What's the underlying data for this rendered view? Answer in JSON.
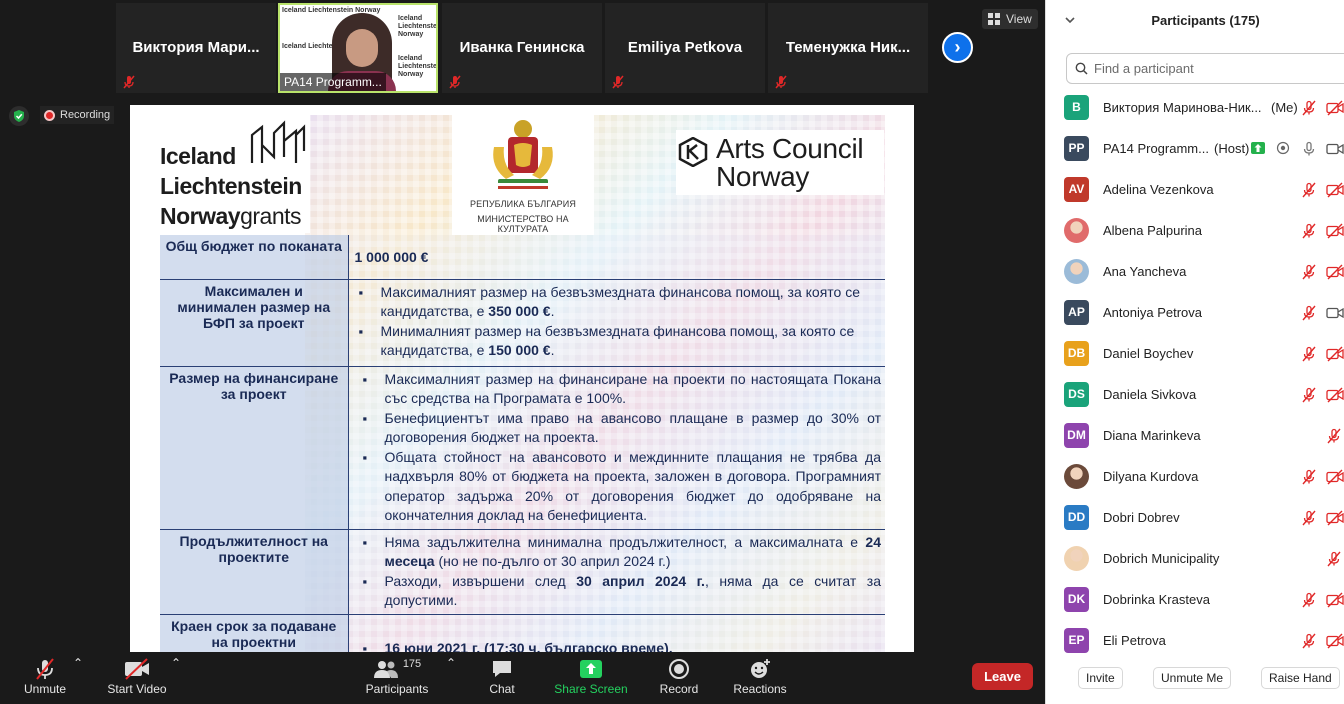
{
  "strip": {
    "tiles": [
      {
        "name": "Виктория  Мари..."
      },
      {
        "name": "PA14 Programm...",
        "watermark": "Iceland Liechtenstein Norway"
      },
      {
        "name": "Иванка Генинска"
      },
      {
        "name": "Emiliya Petkova"
      },
      {
        "name": "Теменужка  Ник..."
      }
    ],
    "view_label": "View"
  },
  "recording_label": "Recording",
  "slide": {
    "logo_eea": {
      "line1": "Iceland",
      "line2": "Liechtenstein",
      "line3a": "Norway",
      "line3b": "grants"
    },
    "logo_bg": {
      "line1": "РЕПУБЛИКА БЪЛГАРИЯ",
      "line2": "МИНИСТЕРСТВО НА КУЛТУРАТА"
    },
    "logo_arts": {
      "line1": "Arts Council",
      "line2": "Norway"
    },
    "rows": [
      {
        "label": "Общ бюджет по поканата",
        "value": "1 000 000 €"
      },
      {
        "label": "Максимален и минимален размер на БФП за проект",
        "items": [
          {
            "pre": "Максималният размер на безвъзмездната финансова помощ, за която се кандидатства, е ",
            "bold": "350 000 €",
            "post": "."
          },
          {
            "pre": "Минималният размер на безвъзмездната финансова помощ, за която се кандидатства, е ",
            "bold": "150 000 €",
            "post": "."
          }
        ]
      },
      {
        "label": "Размер на финансиране за проект",
        "items": [
          {
            "pre": "Максималният размер на финансиране на проекти по настоящата Покана със средства на Програмата е 100%.",
            "bold": "",
            "post": ""
          },
          {
            "pre": "Бенефициентът има право на авансово плащане в размер до 30% от договорения бюджет на проекта.",
            "bold": "",
            "post": ""
          },
          {
            "pre": "Общата стойност на авансовото и междинните плащания не трябва да надхвърля 80% от бюджета на проекта, заложен в договора. Програмният оператор задържа 20% от договорения бюджет до одобряване на окончателния доклад на бенефициента.",
            "bold": "",
            "post": ""
          }
        ]
      },
      {
        "label": "Продължителност на проектите",
        "items": [
          {
            "pre": "Няма задължителна минимална продължителност, а максималната е ",
            "bold": "24 месеца",
            "post": " (но не по-дълго от 30 април 2024 г.)"
          },
          {
            "pre": "Разходи, извършени след ",
            "bold": "30 април 2024 г.",
            "post": ", няма да се считат за допустими."
          }
        ]
      },
      {
        "label": "Краен срок за подаване на проектни",
        "items": [
          {
            "pre": "",
            "bold": "16 юни 2021 г. (17:30 ч. българско време).",
            "post": ""
          }
        ]
      }
    ]
  },
  "toolbar": {
    "unmute": "Unmute",
    "start_video": "Start Video",
    "participants": "Participants",
    "participants_count": "175",
    "chat": "Chat",
    "share_screen": "Share Screen",
    "record": "Record",
    "reactions": "Reactions",
    "leave": "Leave"
  },
  "panel": {
    "title": "Participants (175)",
    "search_placeholder": "Find a participant",
    "participants": [
      {
        "initials": "В",
        "name": "Виктория Маринова-Ник...",
        "tag": "(Me)",
        "color": "#1aa37a",
        "icons": [
          "mic-muted",
          "video-off"
        ]
      },
      {
        "initials": "PP",
        "name": "PA14 Programm...",
        "tag": "(Host)",
        "color": "#3a4a5e",
        "icons": [
          "share",
          "record-dot",
          "mic",
          "video"
        ]
      },
      {
        "initials": "AV",
        "name": "Adelina Vezenkova",
        "tag": "",
        "color": "#c0392b",
        "icons": [
          "mic-muted",
          "video-off"
        ]
      },
      {
        "initials": "",
        "name": "Albena Palpurina",
        "tag": "",
        "color": "#d44",
        "photo": "#e06b6b",
        "icons": [
          "mic-muted",
          "video-off"
        ]
      },
      {
        "initials": "",
        "name": "Ana Yancheva",
        "tag": "",
        "color": "#7a9cbf",
        "photo": "#9bbbd8",
        "icons": [
          "mic-muted",
          "video-off"
        ]
      },
      {
        "initials": "AP",
        "name": "Antoniya Petrova",
        "tag": "",
        "color": "#3a4a5e",
        "icons": [
          "mic-muted",
          "video"
        ]
      },
      {
        "initials": "DB",
        "name": "Daniel Boychev",
        "tag": "",
        "color": "#e8a11c",
        "icons": [
          "mic-muted",
          "video-off"
        ]
      },
      {
        "initials": "DS",
        "name": "Daniela Sivkova",
        "tag": "",
        "color": "#1aa37a",
        "icons": [
          "mic-muted",
          "video-off"
        ]
      },
      {
        "initials": "DM",
        "name": "Diana Marinkeva",
        "tag": "",
        "color": "#8e44ad",
        "icons": [
          "mic-muted"
        ]
      },
      {
        "initials": "",
        "name": "Dilyana Kurdova",
        "tag": "",
        "color": "#5a3a2a",
        "photo": "#6b4a3a",
        "icons": [
          "mic-muted",
          "video-off"
        ]
      },
      {
        "initials": "DD",
        "name": "Dobri Dobrev",
        "tag": "",
        "color": "#2a7bc4",
        "icons": [
          "mic-muted",
          "video-off"
        ]
      },
      {
        "initials": "",
        "name": "Dobrich Municipality",
        "tag": "",
        "color": "#e8c9a0",
        "photo": "#f0d2b0",
        "icons": [
          "mic-muted"
        ]
      },
      {
        "initials": "DK",
        "name": "Dobrinka Krasteva",
        "tag": "",
        "color": "#8e44ad",
        "icons": [
          "mic-muted",
          "video-off"
        ]
      },
      {
        "initials": "EP",
        "name": "Eli Petrova",
        "tag": "",
        "color": "#8e44ad",
        "icons": [
          "mic-muted",
          "video-off"
        ]
      }
    ],
    "footer": {
      "invite": "Invite",
      "unmute_me": "Unmute Me",
      "raise_hand": "Raise Hand"
    }
  },
  "colors": {
    "accent": "#0e71eb",
    "share": "#24d15f",
    "leave": "#c42727",
    "muted": "#e02828"
  }
}
